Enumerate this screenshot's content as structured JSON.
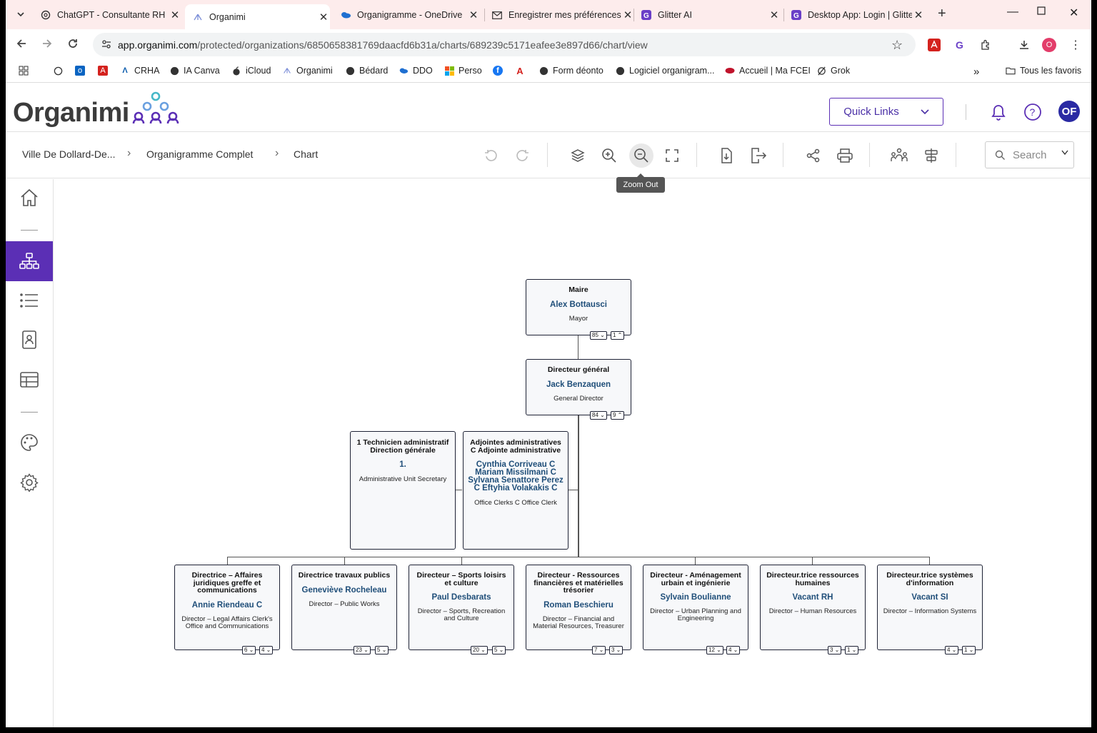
{
  "browser": {
    "tabs": [
      {
        "title": "ChatGPT - Consultante RH",
        "icon": "chatgpt-icon"
      },
      {
        "title": "Organimi",
        "icon": "organimi-icon",
        "active": true
      },
      {
        "title": "Organigramme - OneDrive",
        "icon": "onedrive-icon"
      },
      {
        "title": "Enregistrer mes préférences",
        "icon": "mail-icon"
      },
      {
        "title": "Glitter AI",
        "icon": "glitter-icon"
      },
      {
        "title": "Desktop App: Login | Glitter",
        "icon": "glitter-icon"
      }
    ],
    "url": {
      "domain": "app.organimi.com",
      "path": "/protected/organizations/6850658381769daacfd6b31a/charts/689239c5171eafee3e897d66/chart/view"
    },
    "profile_initial": "O",
    "bookmarks": [
      "CRHA",
      "IA Canva",
      "iCloud",
      "Organimi",
      "Bédard",
      "DDO",
      "Perso",
      "Form déonto",
      "Logiciel organigram...",
      "Accueil | Ma FCEI",
      "Grok"
    ],
    "all_bookmarks": "Tous les favoris"
  },
  "app": {
    "logo_text": "Organimi",
    "quick_links": "Quick Links",
    "avatar_initials": "OF",
    "breadcrumb": [
      "Ville De Dollard-De...",
      "Organigramme Complet",
      "Chart"
    ],
    "search_placeholder": "Search",
    "tooltip": "Zoom Out",
    "accent": "#5b2fb5"
  },
  "org": {
    "mayor": {
      "title": "Maire",
      "name": "Alex Bottausci",
      "role": "Mayor",
      "c1": "85",
      "c2": "1"
    },
    "dg": {
      "title": "Directeur général",
      "name": "Jack Benzaquen",
      "role": "General Director",
      "c1": "84",
      "c2": "9"
    },
    "tech": {
      "title": "1 Technicien administratif Direction générale",
      "name": "1.",
      "role": "Administrative Unit Secretary"
    },
    "adjointes": {
      "title": "Adjointes administratives C Adjointe administrative",
      "name": "Cynthia Corriveau C Mariam Missilmani C Sylvana Senattore Perez C Eftyhia Volakakis C",
      "role": "Office Clerks C Office Clerk"
    },
    "directors": [
      {
        "title": "Directrice – Affaires juridiques greffe et communications",
        "name": "Annie Riendeau C",
        "role": "Director – Legal Affairs Clerk's Office and Communications",
        "c1": "6",
        "c2": "4"
      },
      {
        "title": "Directrice travaux publics",
        "name": "Geneviève Rocheleau",
        "role": "Director – Public Works",
        "c1": "23",
        "c2": "5"
      },
      {
        "title": "Directeur – Sports loisirs et culture",
        "name": "Paul Desbarats",
        "role": "Director – Sports, Recreation and Culture",
        "c1": "20",
        "c2": "5"
      },
      {
        "title": "Directeur - Ressources financières et matérielles trésorier",
        "name": "Roman Beschieru",
        "role": "Director – Financial and Material Resources, Treasurer",
        "c1": "7",
        "c2": "3"
      },
      {
        "title": "Directeur - Aménagement urbain et ingénierie",
        "name": "Sylvain Boulianne",
        "role": "Director – Urban Planning and Engineering",
        "c1": "12",
        "c2": "4"
      },
      {
        "title": "Directeur.trice ressources humaines",
        "name": "Vacant RH",
        "role": "Director – Human Resources",
        "c1": "3",
        "c2": "1"
      },
      {
        "title": "Directeur.trice systèmes d'information",
        "name": "Vacant SI",
        "role": "Director – Information Systems",
        "c1": "4",
        "c2": "1"
      }
    ]
  }
}
